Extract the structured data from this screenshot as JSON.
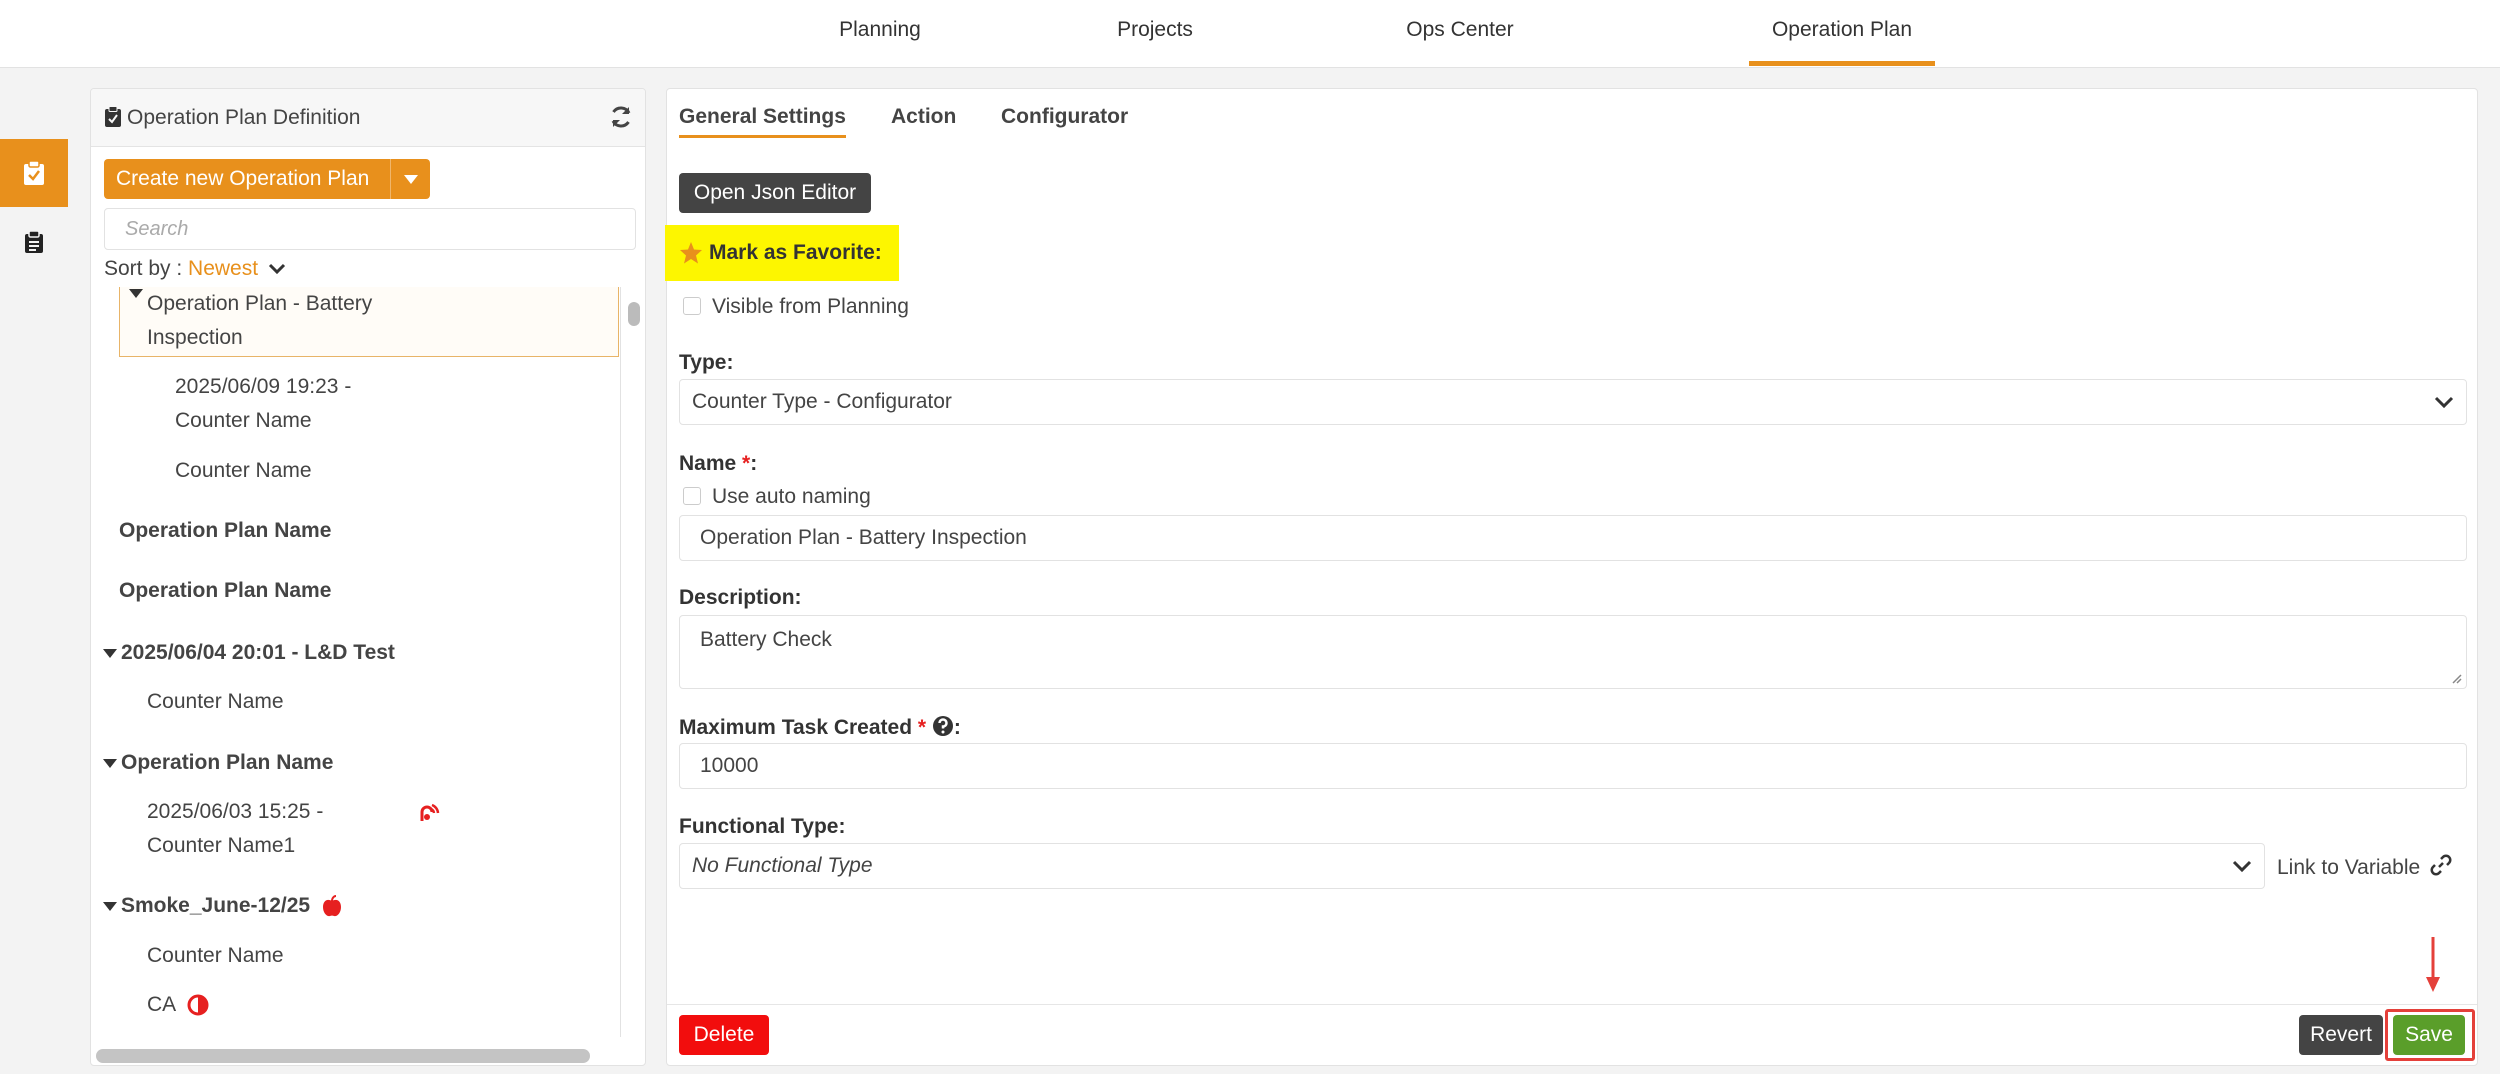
{
  "topnav": {
    "tabs": [
      {
        "label": "Planning"
      },
      {
        "label": "Projects"
      },
      {
        "label": "Ops Center"
      },
      {
        "label": "Operation Plan",
        "active": true
      }
    ]
  },
  "rail": {
    "items": [
      {
        "icon": "clipboard-check-icon",
        "active": true
      },
      {
        "icon": "clipboard-list-icon",
        "active": false
      }
    ]
  },
  "leftpanel": {
    "title": "Operation Plan Definition",
    "create_label": "Create new Operation Plan",
    "search_placeholder": "Search",
    "sort_prefix": "Sort by : ",
    "sort_value": "Newest",
    "tree": {
      "n0_line1": "Operation Plan - Battery",
      "n0_line2": "Inspection",
      "n1_line1": "2025/06/09 19:23 -",
      "n1_line2": "Counter Name",
      "n2": "Counter Name",
      "n3": "Operation Plan Name",
      "n4": "Operation Plan Name",
      "n5": "2025/06/04 20:01 - L&D Test",
      "n6": "Counter Name",
      "n7": "Operation Plan Name",
      "n8_line1": "2025/06/03 15:25 -",
      "n8_line2": "Counter Name1",
      "n9": "Smoke_June-12/25",
      "n10": "Counter Name",
      "n11": "CA"
    }
  },
  "rightpanel": {
    "tabs": [
      {
        "label": "General Settings",
        "active": true
      },
      {
        "label": "Action"
      },
      {
        "label": "Configurator"
      }
    ],
    "json_editor_label": "Open Json Editor",
    "favorite_label": "Mark as Favorite:",
    "visible_from_planning": "Visible from Planning",
    "type_label": "Type:",
    "type_value": "Counter Type - Configurator",
    "name_label": "Name",
    "name_req": "*",
    "name_colon": ":",
    "auto_naming": "Use auto naming",
    "name_value": "Operation Plan - Battery Inspection",
    "description_label": "Description:",
    "description_value": "Battery Check",
    "max_task_label": "Maximum Task Created",
    "max_task_req": "*",
    "max_task_colon": ":",
    "max_task_value": "10000",
    "functional_type_label": "Functional Type:",
    "functional_type_value": "No Functional Type",
    "link_to_variable": "Link to Variable",
    "delete_label": "Delete",
    "revert_label": "Revert",
    "save_label": "Save"
  },
  "colors": {
    "accent": "#e8901c",
    "danger": "#f20d0d",
    "success": "#5a9e2a",
    "highlight": "#fdf600",
    "dark": "#444444"
  }
}
